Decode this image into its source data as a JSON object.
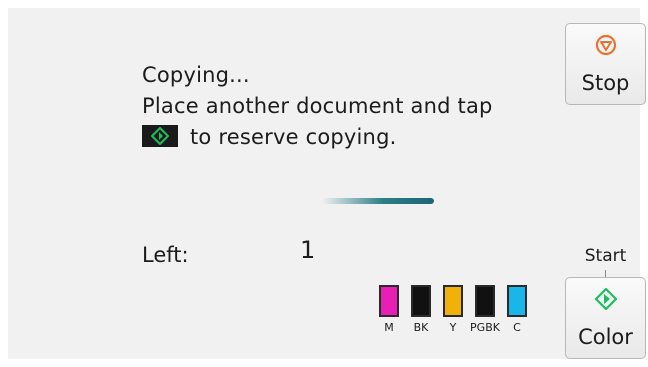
{
  "status": {
    "line1": "Copying...",
    "line2": "Place another document and tap",
    "line3": "to reserve copying."
  },
  "progress": {
    "indeterminate": true
  },
  "counter": {
    "label": "Left:",
    "value": "1"
  },
  "ink": [
    {
      "label": "M",
      "color": "#e81fb5"
    },
    {
      "label": "BK",
      "color": "#111111"
    },
    {
      "label": "Y",
      "color": "#f0b20a"
    },
    {
      "label": "PGBK",
      "color": "#111111"
    },
    {
      "label": "C",
      "color": "#1ab6ea"
    }
  ],
  "buttons": {
    "stop": {
      "label": "Stop",
      "icon": "stop-icon",
      "accent": "#f07030"
    },
    "start_caption": "Start",
    "color": {
      "label": "Color",
      "icon": "start-diamond-icon",
      "accent": "#19c060"
    }
  }
}
